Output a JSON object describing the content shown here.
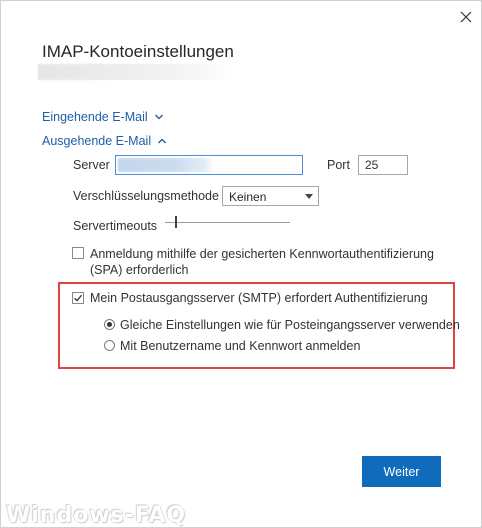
{
  "dialog": {
    "title": "IMAP-Kontoeinstellungen",
    "close_icon": "close-icon"
  },
  "sections": {
    "incoming": {
      "label": "Eingehende E-Mail",
      "icon": "chevron-down-icon"
    },
    "outgoing": {
      "label": "Ausgehende E-Mail",
      "icon": "chevron-up-icon"
    }
  },
  "outgoing_form": {
    "server_label": "Server",
    "server_value": "",
    "port_label": "Port",
    "port_value": "25",
    "encryption_label": "Verschlüsselungsmethode",
    "encryption_value": "Keinen",
    "timeout_label": "Servertimeouts",
    "timeout_level": 0.08,
    "spa_label": "Anmeldung mithilfe der gesicherten Kennwortauthentifizierung (SPA) erforderlich",
    "spa_checked": false,
    "smtp_auth_label": "Mein Postausgangsserver (SMTP) erfordert Authentifizierung",
    "smtp_auth_checked": true,
    "radio_same_label": "Gleiche Einstellungen wie für Posteingangsserver verwenden",
    "radio_same_selected": true,
    "radio_login_label": "Mit Benutzername und Kennwort anmelden",
    "radio_login_selected": false
  },
  "footer": {
    "next_label": "Weiter"
  },
  "watermark": {
    "text": "Windows-FAQ"
  },
  "colors": {
    "accent": "#0f6cbd",
    "link": "#1e5fa8",
    "highlight": "#e0433f"
  }
}
